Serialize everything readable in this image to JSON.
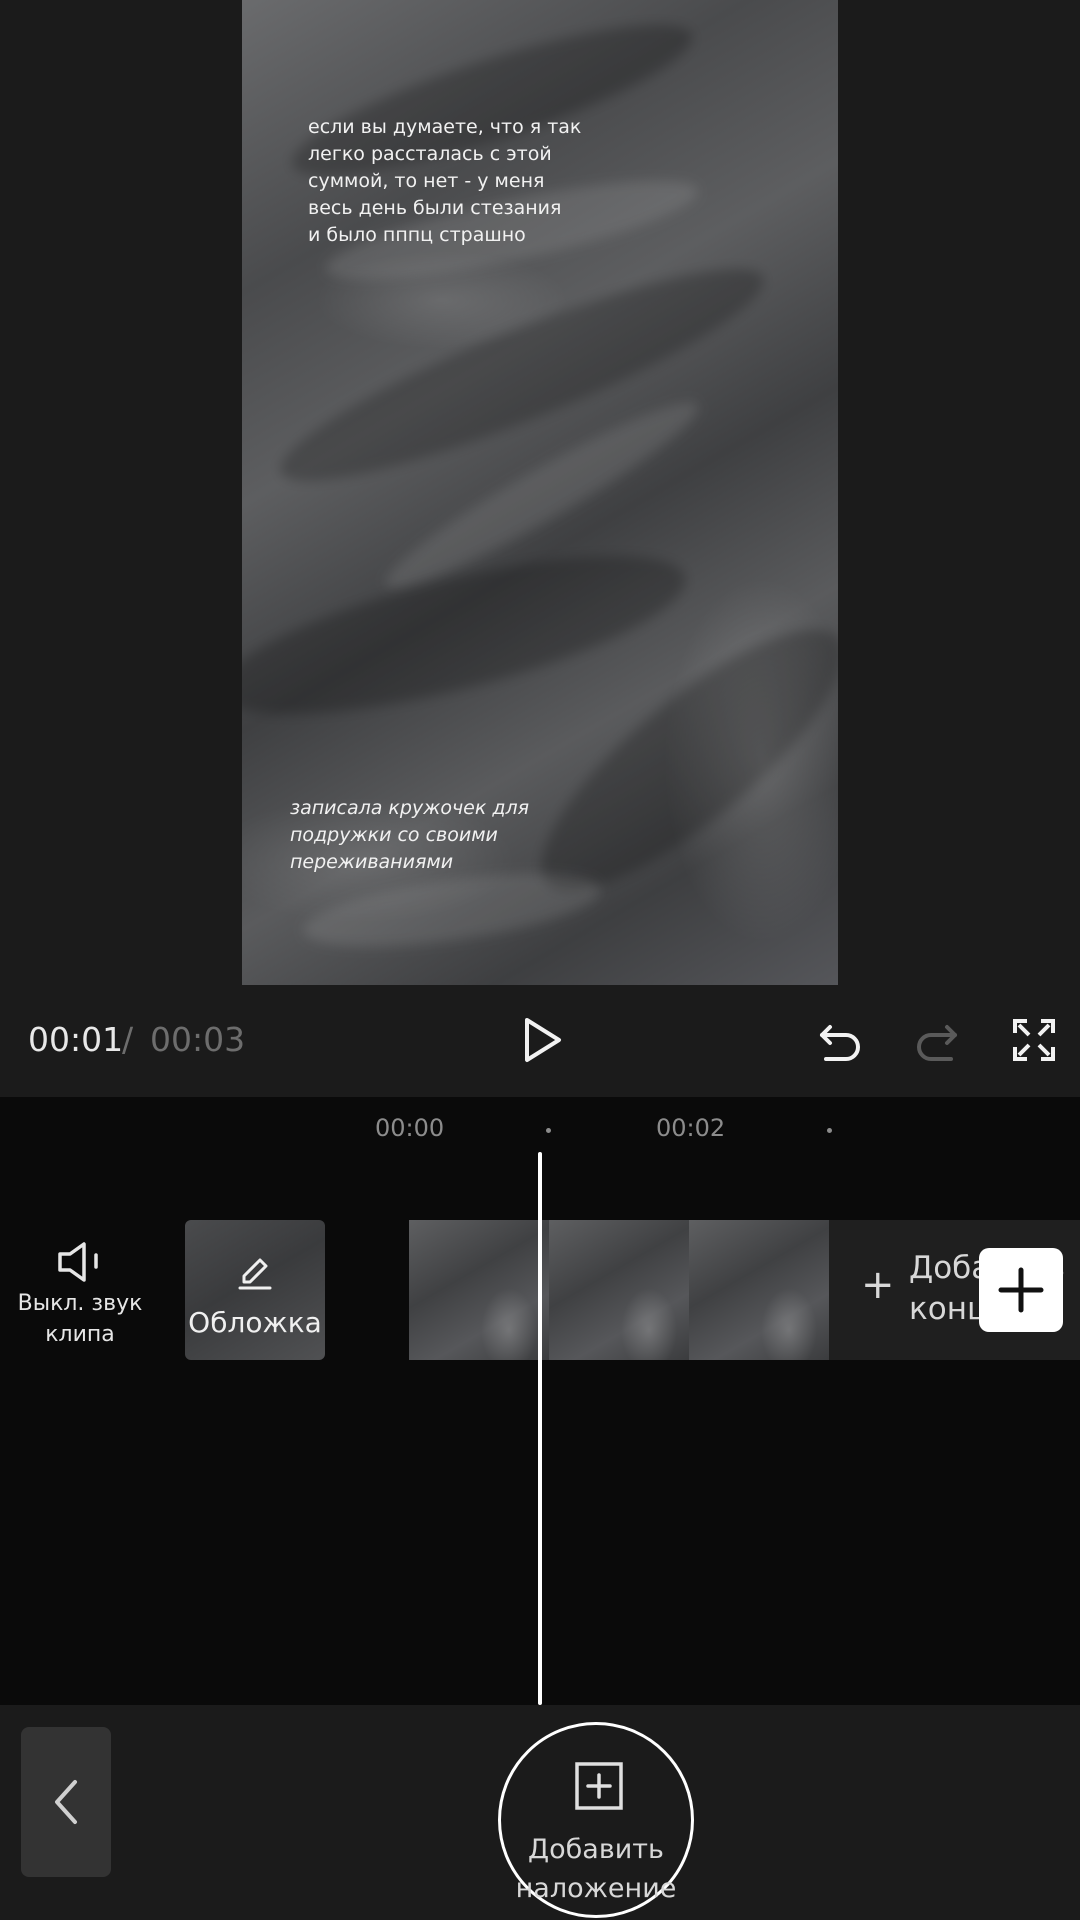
{
  "preview": {
    "overlay_text_top": "если вы думаете, что я так\nлегко рассталась с этой\nсуммой, то нет - у меня\nвесь день были стезания\nи было пппц страшно",
    "overlay_text_bottom": "записала кружочек для\nподружки со своими\nпереживаниями"
  },
  "player": {
    "current_time": "00:01",
    "separator": "/",
    "total_time": "00:03"
  },
  "timeline": {
    "ruler_labels": [
      "00:00",
      "00:02"
    ],
    "mute_label": "Выкл. звук\nклипа",
    "cover_label": "Обложка",
    "add_end_label": "Добавить\nконцовку"
  },
  "bottom": {
    "add_overlay_label": "Добавить\nналожение"
  },
  "icons": {
    "play": "play-icon",
    "undo": "undo-icon",
    "redo": "redo-icon",
    "fullscreen": "fullscreen-icon",
    "mute": "speaker-mute-icon",
    "edit": "pencil-icon",
    "add": "plus-icon",
    "back": "chevron-left-icon",
    "overlay": "add-overlay-icon"
  }
}
